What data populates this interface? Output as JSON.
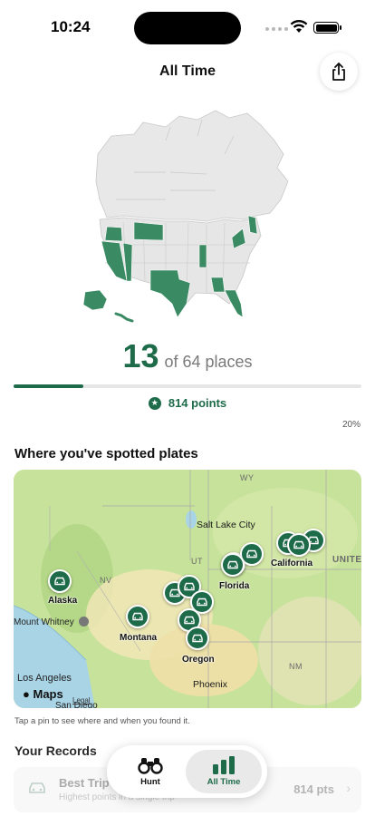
{
  "status_bar": {
    "time": "10:24"
  },
  "header": {
    "title": "All Time",
    "share_icon": "share-icon"
  },
  "summary": {
    "count": "13",
    "count_rest": "of 64 places",
    "progress": 0.2,
    "points": "814 points",
    "percent": "20%"
  },
  "spotted": {
    "heading": "Where you've spotted plates",
    "map_labels": {
      "salt_lake_city": "Salt Lake City",
      "nv": "NV",
      "ut": "UT",
      "wy": "WY",
      "nm": "NM",
      "mount_whitney": "Mount Whitney",
      "los_angeles": "Los Angeles",
      "san_diego": "San Diego",
      "phoenix": "Phoenix",
      "united": "UNITE"
    },
    "pin_labels": {
      "alaska": "Alaska",
      "montana": "Montana",
      "florida": "Florida",
      "oregon": "Oregon",
      "california": "California"
    },
    "maps_brand": "Maps",
    "legal": "Legal",
    "hint": "Tap a pin to see where and when you found it."
  },
  "records": {
    "heading": "Your Records",
    "items": [
      {
        "title": "Best Trip",
        "subtitle": "Highest points in a single trip",
        "value": "814 pts"
      }
    ]
  },
  "tabs": [
    {
      "label": "Hunt",
      "icon": "binoculars-icon"
    },
    {
      "label": "All Time",
      "icon": "bar-chart-icon"
    }
  ],
  "colors": {
    "accent": "#1e6b4a",
    "visited_state": "#3a8a63",
    "unvisited_state": "#e6e6e6"
  }
}
